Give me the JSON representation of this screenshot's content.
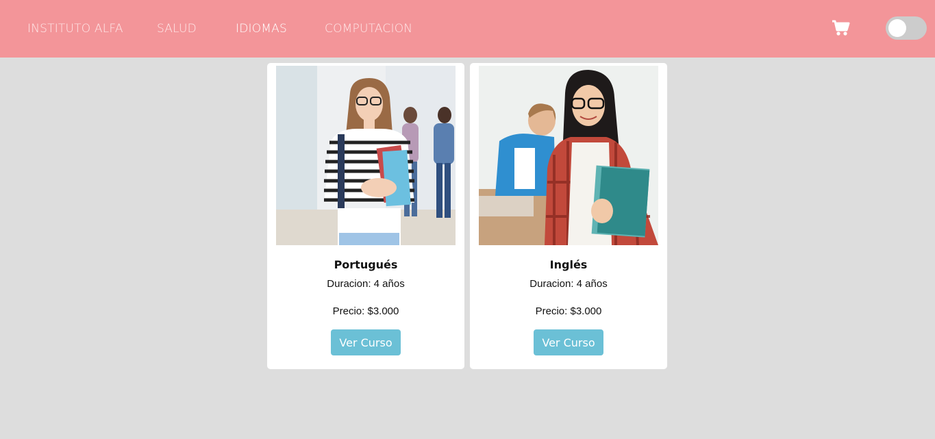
{
  "nav": {
    "brand": "INSTITUTO ALFA",
    "links": [
      "SALUD",
      "IDIOMAS",
      "COMPUTACION"
    ],
    "active": "IDIOMAS",
    "cart_icon": "shopping-cart-icon",
    "theme_toggle": "off"
  },
  "colors": {
    "navbar": "#f39599",
    "background": "#dddddd",
    "button": "#6bc0d6"
  },
  "cards": [
    {
      "title": "Portugués",
      "duration": "Duracion: 4 años",
      "price": "Precio: $3.000",
      "button": "Ver Curso"
    },
    {
      "title": "Inglés",
      "duration": "Duracion: 4 años",
      "price": "Precio: $3.000",
      "button": "Ver Curso"
    }
  ]
}
